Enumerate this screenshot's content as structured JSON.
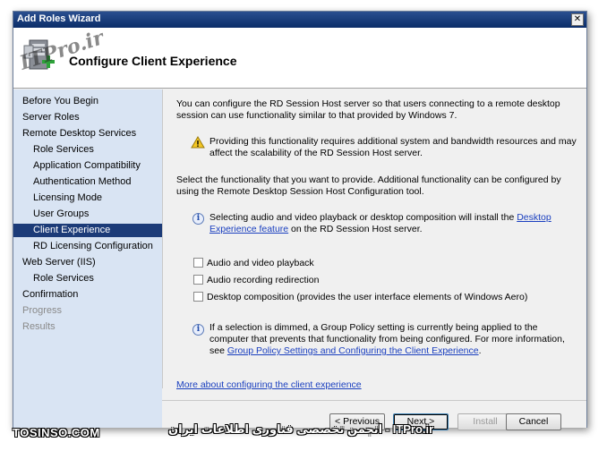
{
  "window": {
    "title": "Add Roles Wizard",
    "close_glyph": "✕"
  },
  "header": {
    "title": "Configure Client Experience",
    "icon": "server-roles-add-icon"
  },
  "watermark": {
    "logo_text": "ITPro.ir",
    "bottom_left": "TOSINSO.COM",
    "bottom_right": "ITPro.ir - انجمن تخصصی فناوری اطلاعات ایران"
  },
  "sidebar": {
    "items": [
      {
        "label": "Before You Begin"
      },
      {
        "label": "Server Roles"
      },
      {
        "label": "Remote Desktop Services"
      },
      {
        "label": "Role Services"
      },
      {
        "label": "Application Compatibility"
      },
      {
        "label": "Authentication Method"
      },
      {
        "label": "Licensing Mode"
      },
      {
        "label": "User Groups"
      },
      {
        "label": "Client Experience"
      },
      {
        "label": "RD Licensing Configuration"
      },
      {
        "label": "Web Server (IIS)"
      },
      {
        "label": "Role Services"
      },
      {
        "label": "Confirmation"
      },
      {
        "label": "Progress"
      },
      {
        "label": "Results"
      }
    ]
  },
  "main": {
    "intro": "You can configure the RD Session Host server so that users connecting to a remote desktop session can use functionality similar to that provided by Windows 7.",
    "warning": "Providing this functionality requires additional system and bandwidth resources and may affect the scalability of the RD Session Host server.",
    "select_text": "Select the functionality that you want to provide. Additional functionality can be configured by using the Remote Desktop Session Host Configuration tool.",
    "info1_prefix": "Selecting audio and video playback or desktop composition will install the ",
    "info1_link": "Desktop Experience feature",
    "info1_suffix": " on the RD Session Host server.",
    "checkboxes": [
      {
        "label": "Audio and video playback",
        "checked": false
      },
      {
        "label": "Audio recording redirection",
        "checked": false
      },
      {
        "label": "Desktop composition (provides the user interface elements of Windows Aero)",
        "checked": false
      }
    ],
    "info2_prefix": "If a selection is dimmed, a Group Policy setting is currently being applied to the computer that prevents that functionality from being configured. For more information, see ",
    "info2_link": "Group Policy Settings and Configuring the Client Experience",
    "info2_suffix": ".",
    "more_link": "More about configuring the client experience"
  },
  "buttons": {
    "previous": "< Previous",
    "next": "Next >",
    "install": "Install",
    "cancel": "Cancel"
  }
}
